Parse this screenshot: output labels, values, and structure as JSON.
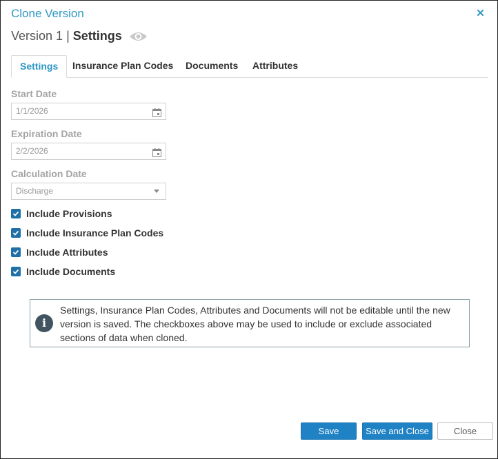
{
  "dialog": {
    "title": "Clone Version",
    "close_icon": "close-icon"
  },
  "header": {
    "version_name": "Version 1",
    "separator": "|",
    "section": "Settings",
    "visibility_icon": "eye-icon"
  },
  "tabs": [
    {
      "label": "Settings",
      "active": true
    },
    {
      "label": "Insurance Plan Codes",
      "active": false
    },
    {
      "label": "Documents",
      "active": false
    },
    {
      "label": "Attributes",
      "active": false
    }
  ],
  "form": {
    "start_date": {
      "label": "Start Date",
      "value": "1/1/2026",
      "icon": "calendar-icon"
    },
    "expiration_date": {
      "label": "Expiration Date",
      "value": "2/2/2026",
      "icon": "calendar-icon"
    },
    "calculation_date": {
      "label": "Calculation Date",
      "value": "Discharge",
      "icon": "chevron-down-icon"
    }
  },
  "checkboxes": [
    {
      "label": "Include Provisions",
      "checked": true
    },
    {
      "label": "Include Insurance Plan Codes",
      "checked": true
    },
    {
      "label": "Include Attributes",
      "checked": true
    },
    {
      "label": "Include Documents",
      "checked": true
    }
  ],
  "info": {
    "icon": "info-icon",
    "icon_glyph": "i",
    "text": "Settings, Insurance Plan Codes, Attributes and Documents will not be editable until the new version is saved. The checkboxes above may be used to include or exclude associated sections of data when cloned."
  },
  "buttons": {
    "save": "Save",
    "save_and_close": "Save and Close",
    "close": "Close"
  },
  "colors": {
    "accent": "#2e97c5",
    "primary_button": "#1f82c4",
    "checkbox": "#1f70a6",
    "info_icon": "#415460"
  }
}
